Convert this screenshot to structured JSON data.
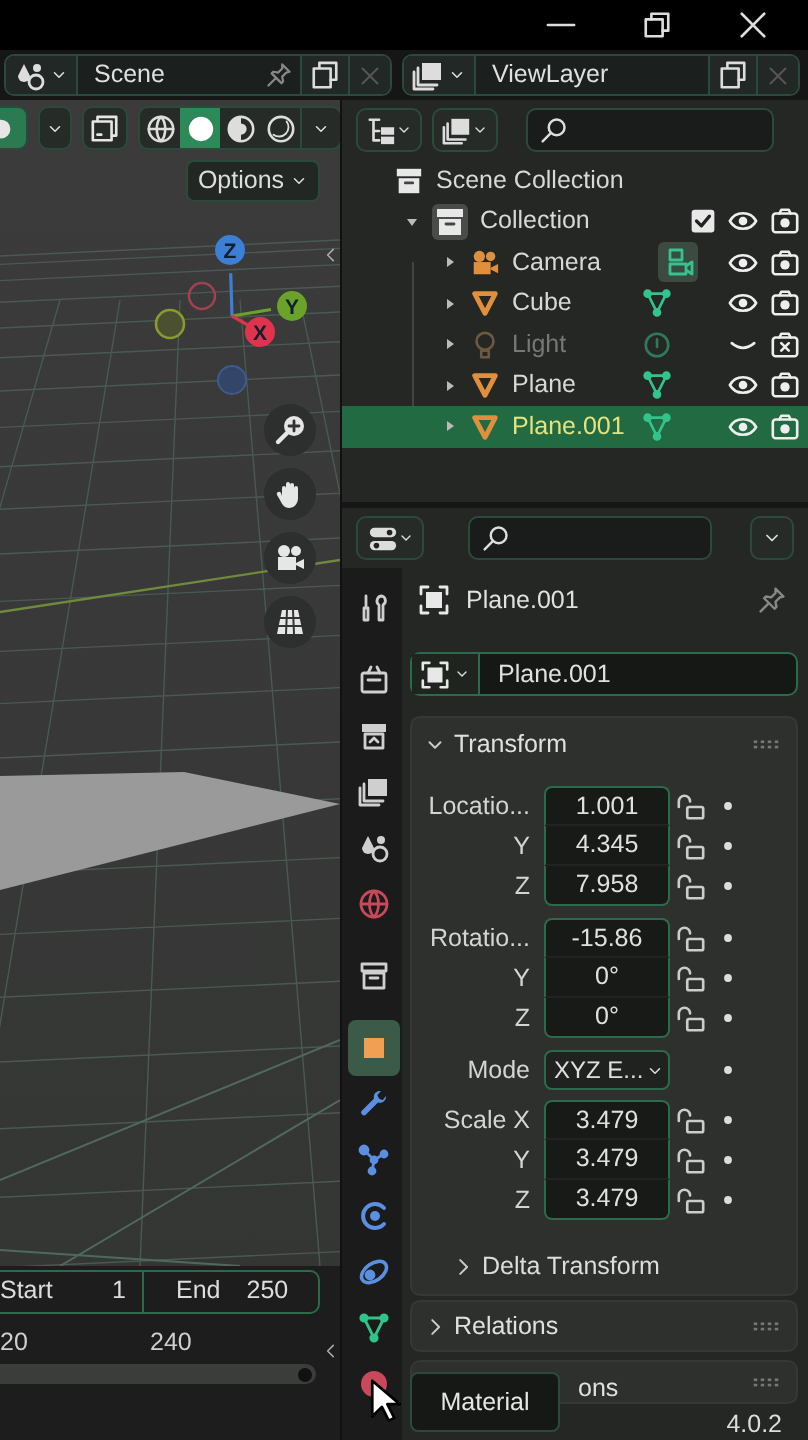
{
  "window_controls": [
    {
      "kind": "minimize"
    },
    {
      "kind": "maximize"
    },
    {
      "kind": "close"
    }
  ],
  "scene_selector": {
    "value": "Scene"
  },
  "view_layer_selector": {
    "value": "ViewLayer"
  },
  "viewport": {
    "header_toggles": [
      {
        "kind": "gizmo",
        "on": true
      },
      {
        "kind": "overlay",
        "on": false
      }
    ],
    "shading_modes": [
      {
        "kind": "wireframe",
        "selected": false
      },
      {
        "kind": "solid",
        "selected": true
      },
      {
        "kind": "material",
        "selected": false
      },
      {
        "kind": "rendered",
        "selected": false
      }
    ],
    "options_button": "Options",
    "gizmo_axes": [
      {
        "label": "Z",
        "kind": "z"
      },
      {
        "label": "Y",
        "kind": "y"
      },
      {
        "label": "X",
        "kind": "x"
      }
    ],
    "nav_buttons": [
      {
        "kind": "zoom"
      },
      {
        "kind": "pan"
      },
      {
        "kind": "camera"
      },
      {
        "kind": "ortho"
      }
    ]
  },
  "timeline": {
    "start_label": "Start",
    "start": "1",
    "end_label": "End",
    "end": "250",
    "ruler": [
      "20",
      "240"
    ]
  },
  "outliner": {
    "items": [
      {
        "label": "Scene Collection",
        "kind": "scene_collection",
        "children": [
          {
            "label": "Collection",
            "kind": "collection",
            "expanded": true,
            "checked": true,
            "visible": true,
            "renderable": true,
            "selected": false,
            "children": [
              {
                "label": "Camera",
                "kind": "camera",
                "data": {
                  "kind": "camera_data",
                  "highlighted": true
                },
                "expanded": false,
                "visible": true,
                "renderable": true,
                "selected": false
              },
              {
                "label": "Cube",
                "kind": "mesh",
                "data": {
                  "kind": "mesh_data",
                  "highlighted": false
                },
                "expanded": false,
                "visible": true,
                "renderable": true,
                "selected": false
              },
              {
                "label": "Light",
                "kind": "light",
                "data": {
                  "kind": "light_data",
                  "highlighted": false
                },
                "expanded": false,
                "visible": false,
                "renderable": false,
                "selected": false
              },
              {
                "label": "Plane",
                "kind": "mesh",
                "data": {
                  "kind": "mesh_data",
                  "highlighted": false
                },
                "expanded": false,
                "visible": true,
                "renderable": true,
                "selected": false
              },
              {
                "label": "Plane.001",
                "kind": "mesh",
                "data": {
                  "kind": "mesh_data",
                  "highlighted": false
                },
                "expanded": false,
                "visible": true,
                "renderable": true,
                "selected": true
              }
            ]
          }
        ]
      }
    ]
  },
  "properties": {
    "tab_groups": [
      [
        {
          "kind": "tool",
          "selected": false
        }
      ],
      [
        {
          "kind": "render",
          "selected": false
        },
        {
          "kind": "output",
          "selected": false
        },
        {
          "kind": "view_layer",
          "selected": false
        },
        {
          "kind": "scene",
          "selected": false
        },
        {
          "kind": "world",
          "selected": false
        }
      ],
      [
        {
          "kind": "collection",
          "selected": false
        }
      ],
      [
        {
          "kind": "object",
          "selected": true
        },
        {
          "kind": "modifiers",
          "selected": false
        },
        {
          "kind": "particles",
          "selected": false
        },
        {
          "kind": "physics",
          "selected": false
        },
        {
          "kind": "constraints",
          "selected": false
        },
        {
          "kind": "data",
          "selected": false
        },
        {
          "kind": "material",
          "selected": false
        }
      ]
    ],
    "object_title": "Plane.001",
    "object_name": "Plane.001",
    "panels": [
      {
        "title": "Transform",
        "expanded": true,
        "groups": [
          {
            "kind": "vector",
            "rows": [
              {
                "label": "Locatio...",
                "value": "1.001",
                "locked": false
              },
              {
                "label": "Y",
                "value": "4.345",
                "locked": false
              },
              {
                "label": "Z",
                "value": "7.958",
                "locked": false
              }
            ]
          },
          {
            "kind": "vector",
            "rows": [
              {
                "label": "Rotatio...",
                "value": "-15.86",
                "locked": false
              },
              {
                "label": "Y",
                "value": "0°",
                "locked": false
              },
              {
                "label": "Z",
                "value": "0°",
                "locked": false
              }
            ]
          },
          {
            "kind": "dropdown",
            "label": "Mode",
            "value": "XYZ E..."
          },
          {
            "kind": "vector",
            "rows": [
              {
                "label": "Scale X",
                "value": "3.479",
                "locked": false
              },
              {
                "label": "Y",
                "value": "3.479",
                "locked": false
              },
              {
                "label": "Z",
                "value": "3.479",
                "locked": false
              }
            ]
          }
        ],
        "subpanels": [
          {
            "title": "Delta Transform",
            "expanded": false
          }
        ]
      },
      {
        "title": "Relations",
        "expanded": false
      },
      {
        "title": "ons"
      }
    ]
  },
  "tooltip": "Material",
  "version": "4.0.2"
}
